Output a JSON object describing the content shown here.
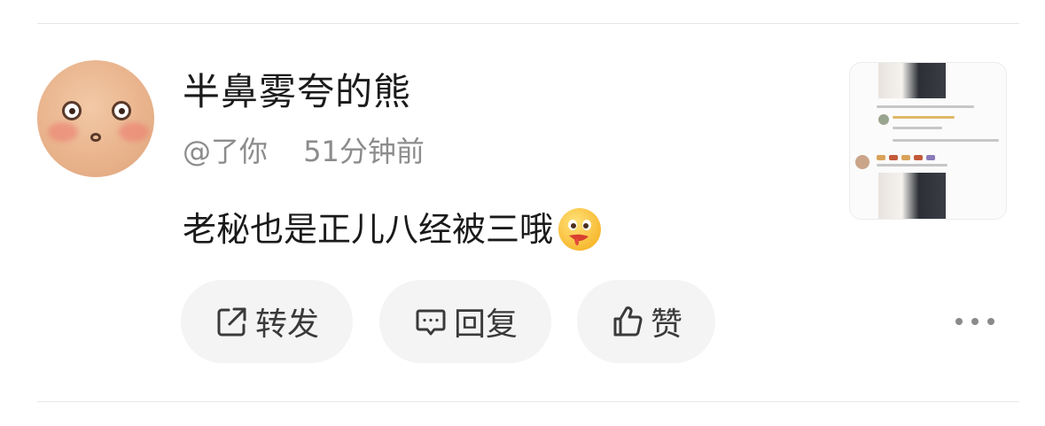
{
  "post": {
    "username": "半鼻雾夸的熊",
    "mention": "@了你",
    "time": "51分钟前",
    "comment_text": "老秘也是正儿八经被三哦",
    "comment_emoji": "drooling-face-emoji"
  },
  "actions": {
    "forward_label": "转发",
    "reply_label": "回复",
    "like_label": "赞"
  },
  "icons": {
    "forward": "share-arrow-icon",
    "reply": "comment-bubble-icon",
    "like": "thumbs-up-icon",
    "more": "ellipsis-icon"
  },
  "colors": {
    "text_primary": "#1a1a1a",
    "text_secondary": "#8c8c8c",
    "button_bg": "#f4f4f4",
    "divider": "#e6e6e6"
  }
}
